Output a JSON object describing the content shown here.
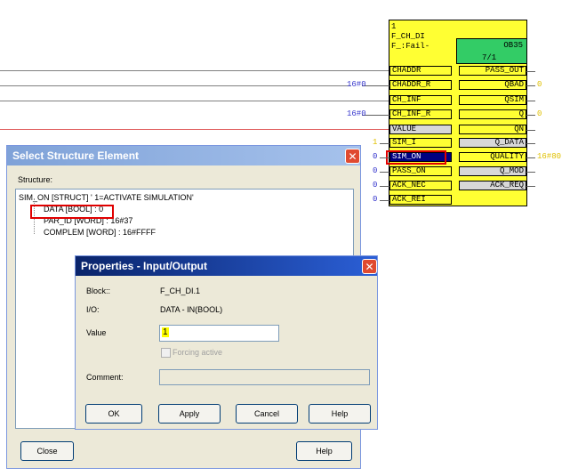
{
  "block": {
    "number": "1",
    "type": "F_CH_DI",
    "name": "F_:Fail-",
    "ob": "OB35",
    "ob_sub": "7/1",
    "inputs": [
      {
        "name": "CHADDR",
        "value": ""
      },
      {
        "name": "CHADDR_R",
        "value": "16#0"
      },
      {
        "name": "CH_INF",
        "value": ""
      },
      {
        "name": "CH_INF_R",
        "value": "16#0"
      },
      {
        "name": "VALUE",
        "value": ""
      },
      {
        "name": "SIM_I",
        "value": "1"
      },
      {
        "name": "SIM_ON",
        "value": "0"
      },
      {
        "name": "PASS_ON",
        "value": "0"
      },
      {
        "name": "ACK_NEC",
        "value": "0"
      },
      {
        "name": "ACK_REI",
        "value": "0"
      }
    ],
    "outputs": [
      {
        "name": "PASS_OUT",
        "value": ""
      },
      {
        "name": "QBAD",
        "value": "0"
      },
      {
        "name": "QSIM",
        "value": ""
      },
      {
        "name": "Q",
        "value": "0"
      },
      {
        "name": "QN",
        "value": ""
      },
      {
        "name": "Q_DATA",
        "value": ""
      },
      {
        "name": "QUALITY",
        "value": "16#80"
      },
      {
        "name": "Q_MOD",
        "value": ""
      },
      {
        "name": "ACK_REQ",
        "value": ""
      }
    ]
  },
  "select_dialog": {
    "title": "Select Structure Element",
    "structure_label": "Structure:",
    "tree": [
      "SIM_ON [STRUCT] ' 1=ACTIVATE SIMULATION'",
      "DATA [BOOL] : 0",
      "PAR_ID [WORD] : 16#37",
      "COMPLEM [WORD] : 16#FFFF"
    ],
    "close_label": "Close",
    "help_label": "Help"
  },
  "props_dialog": {
    "title": "Properties - Input/Output",
    "block_label": "Block::",
    "block_value": "F_CH_DI.1",
    "io_label": "I/O:",
    "io_value": "DATA  - IN(BOOL)",
    "value_label": "Value",
    "value_text": "1",
    "forcing_label": "Forcing active",
    "comment_label": "Comment:",
    "ok_label": "OK",
    "apply_label": "Apply",
    "cancel_label": "Cancel",
    "help_label": "Help"
  },
  "colors": {
    "block_fill": "#ffff33",
    "ob_fill": "#33cc66",
    "titlebar_blue": "#0a246a",
    "highlight_red": "#e00000"
  }
}
